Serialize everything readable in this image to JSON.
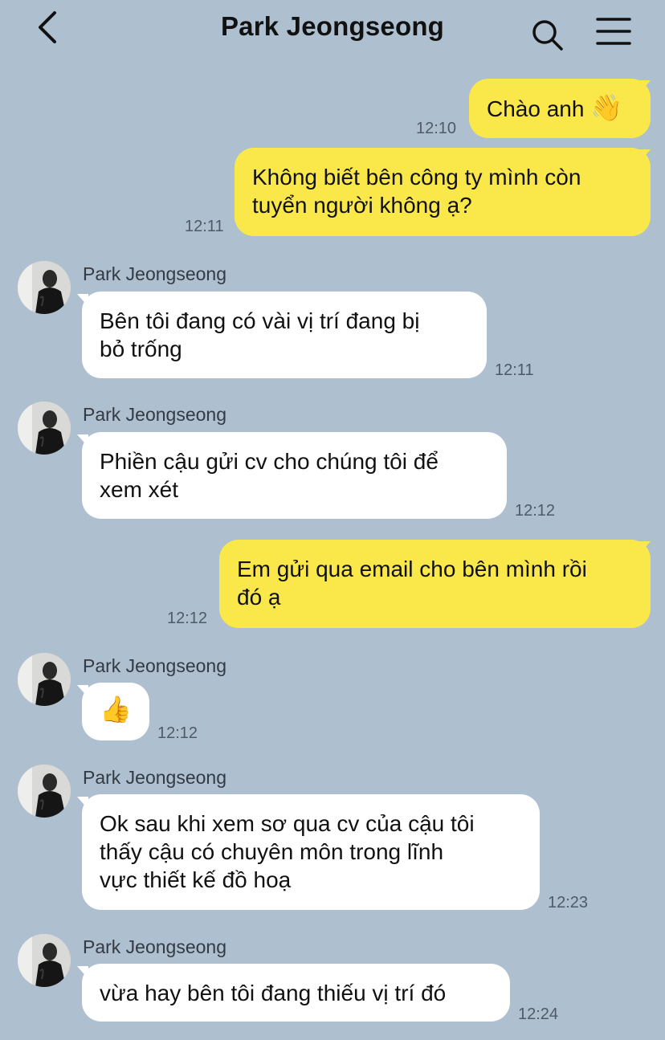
{
  "header": {
    "title": "Park Jeongseong"
  },
  "icons": {
    "back": "chevron-left-icon",
    "search": "search-icon",
    "menu": "hamburger-menu-icon",
    "wave": "waving-hand-emoji",
    "thumbs": "thumbs-up-emoji"
  },
  "colors": {
    "background": "#aebfd0",
    "my_bubble": "#fae84a",
    "their_bubble": "#ffffff"
  },
  "messages": [
    {
      "from": "me",
      "lines": [
        "Chào anh"
      ],
      "emoji": "👋",
      "time": "12:10"
    },
    {
      "from": "me",
      "lines": [
        "Không biết bên công ty mình còn",
        "tuyển người không ạ?"
      ],
      "time": "12:11"
    },
    {
      "from": "them",
      "sender": "Park Jeongseong",
      "lines": [
        "Bên tôi đang có vài vị trí đang bị",
        "bỏ trống"
      ],
      "time": "12:11"
    },
    {
      "from": "them",
      "sender": "Park Jeongseong",
      "lines": [
        "Phiền cậu gửi cv cho chúng tôi để",
        "xem xét"
      ],
      "time": "12:12"
    },
    {
      "from": "me",
      "lines": [
        "Em gửi qua email cho bên mình rồi",
        "đó ạ"
      ],
      "time": "12:12"
    },
    {
      "from": "them",
      "sender": "Park Jeongseong",
      "lines": [],
      "emoji": "👍",
      "time": "12:12"
    },
    {
      "from": "them",
      "sender": "Park Jeongseong",
      "lines": [
        "Ok sau khi xem sơ qua cv của cậu tôi",
        "thấy cậu có chuyên môn trong lĩnh",
        "vực thiết kế đồ hoạ"
      ],
      "time": "12:23"
    },
    {
      "from": "them",
      "sender": "Park Jeongseong",
      "lines": [
        "vừa hay bên tôi đang thiếu vị trí đó"
      ],
      "time": "12:24"
    }
  ]
}
